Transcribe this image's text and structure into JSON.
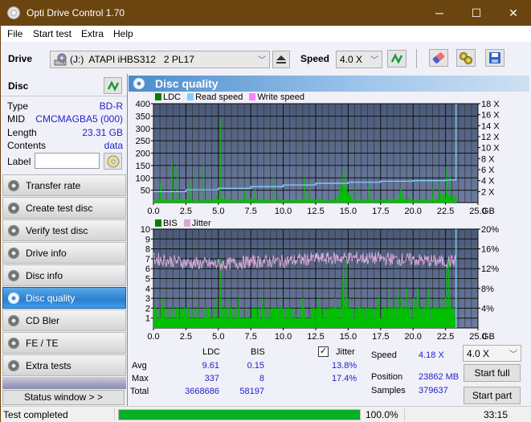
{
  "window": {
    "title": "Opti Drive Control 1.70",
    "controls": {
      "minimize": "─",
      "maximize": "☐",
      "close": "✕"
    }
  },
  "menu": [
    "File",
    "Start test",
    "Extra",
    "Help"
  ],
  "toolbar": {
    "drive_label": "Drive",
    "drive_value": "(J:)  ATAPI iHBS312   2 PL17",
    "speed_label": "Speed",
    "speed_value": "4.0 X",
    "icons": [
      "drive-icon",
      "eject-icon",
      "refresh-icon",
      "erase-icon",
      "settings-icon",
      "save-icon"
    ]
  },
  "disc": {
    "header": "Disc",
    "rows": [
      {
        "key": "Type",
        "value": "BD-R"
      },
      {
        "key": "MID",
        "value": "CMCMAGBA5 (000)"
      },
      {
        "key": "Length",
        "value": "23.31 GB"
      },
      {
        "key": "Contents",
        "value": "data"
      }
    ],
    "label_key": "Label",
    "label_value": ""
  },
  "nav": [
    {
      "label": "Transfer rate",
      "active": false
    },
    {
      "label": "Create test disc",
      "active": false
    },
    {
      "label": "Verify test disc",
      "active": false
    },
    {
      "label": "Drive info",
      "active": false
    },
    {
      "label": "Disc info",
      "active": false
    },
    {
      "label": "Disc quality",
      "active": true
    },
    {
      "label": "CD Bler",
      "active": false
    },
    {
      "label": "FE / TE",
      "active": false
    },
    {
      "label": "Extra tests",
      "active": false
    }
  ],
  "status_window_button": "Status window > >",
  "panel": {
    "title": "Disc quality"
  },
  "colors": {
    "ldc": "#00c000",
    "read_speed": "#7fd0ff",
    "write_speed": "#ff80ff",
    "bis": "#00c000",
    "jitter": "#d8a8d8",
    "plot_bg_top": "#4a5a78",
    "plot_bg_bottom": "#6c7ca0",
    "accent": "#2b7fd0",
    "progress": "#06b025"
  },
  "chart_data": [
    {
      "type": "bar",
      "title": "LDC / Read speed",
      "legend": [
        "LDC",
        "Read speed",
        "Write speed"
      ],
      "legend_placement": "top-left",
      "x_ticks": [
        "0.0",
        "2.5",
        "5.0",
        "7.5",
        "10.0",
        "12.5",
        "15.0",
        "17.5",
        "20.0",
        "22.5",
        "25.0"
      ],
      "x_unit": "GB",
      "xlim": [
        0,
        25
      ],
      "y_ticks": [
        "50",
        "100",
        "150",
        "200",
        "250",
        "300",
        "350",
        "400"
      ],
      "ylim": [
        0,
        400
      ],
      "y2_ticks": [
        "2 X",
        "4 X",
        "6 X",
        "8 X",
        "10 X",
        "12 X",
        "14 X",
        "16 X",
        "18 X"
      ],
      "y2lim": [
        0,
        18
      ],
      "grid": true,
      "end_marker_gb": 23.31,
      "ldc_peaks": [
        [
          0.3,
          40
        ],
        [
          0.5,
          75
        ],
        [
          1.4,
          162
        ],
        [
          1.8,
          150
        ],
        [
          2.8,
          85
        ],
        [
          3.2,
          130
        ],
        [
          3.8,
          155
        ],
        [
          5.15,
          337
        ],
        [
          7.0,
          50
        ],
        [
          7.8,
          60
        ],
        [
          9.2,
          105
        ],
        [
          11.6,
          100
        ],
        [
          12.0,
          90
        ],
        [
          14.5,
          110
        ],
        [
          14.75,
          150
        ],
        [
          15.5,
          60
        ],
        [
          16.5,
          70
        ],
        [
          19.0,
          55
        ],
        [
          21.5,
          65
        ],
        [
          22.0,
          80
        ],
        [
          22.5,
          145
        ],
        [
          22.8,
          110
        ]
      ],
      "read_speed": [
        [
          0,
          2.0
        ],
        [
          2.5,
          2.3
        ],
        [
          5.0,
          2.6
        ],
        [
          7.5,
          2.9
        ],
        [
          10.0,
          3.2
        ],
        [
          12.5,
          3.5
        ],
        [
          15.0,
          3.7
        ],
        [
          17.5,
          3.9
        ],
        [
          20.0,
          4.0
        ],
        [
          22.5,
          4.1
        ],
        [
          23.31,
          4.18
        ]
      ]
    },
    {
      "type": "bar",
      "title": "BIS / Jitter",
      "legend": [
        "BIS",
        "Jitter"
      ],
      "legend_placement": "top-left",
      "x_ticks": [
        "0.0",
        "2.5",
        "5.0",
        "7.5",
        "10.0",
        "12.5",
        "15.0",
        "17.5",
        "20.0",
        "22.5",
        "25.0"
      ],
      "x_unit": "GB",
      "xlim": [
        0,
        25
      ],
      "y_ticks": [
        "1",
        "2",
        "3",
        "4",
        "5",
        "6",
        "7",
        "8",
        "9",
        "10"
      ],
      "ylim": [
        0,
        10
      ],
      "y2_ticks": [
        "4%",
        "8%",
        "12%",
        "16%",
        "20%"
      ],
      "y2lim": [
        0,
        20
      ],
      "grid": true,
      "end_marker_gb": 23.31,
      "bis_peaks": [
        [
          5.15,
          7
        ],
        [
          14.6,
          6
        ],
        [
          14.8,
          7
        ],
        [
          22.5,
          6
        ],
        [
          22.7,
          7
        ]
      ],
      "jitter_mean_pct": [
        [
          0,
          14.0
        ],
        [
          2.5,
          13.2
        ],
        [
          5.0,
          12.8
        ],
        [
          7.5,
          13.4
        ],
        [
          10.0,
          13.5
        ],
        [
          12.5,
          14.0
        ],
        [
          15.0,
          14.2
        ],
        [
          17.5,
          14.0
        ],
        [
          20.0,
          13.8
        ],
        [
          22.5,
          13.4
        ],
        [
          23.31,
          13.6
        ]
      ]
    }
  ],
  "stats": {
    "headers": [
      "LDC",
      "BIS"
    ],
    "rows": [
      {
        "label": "Avg",
        "ldc": "9.61",
        "bis": "0.15",
        "jitter": "13.8%"
      },
      {
        "label": "Max",
        "ldc": "337",
        "bis": "8",
        "jitter": "17.4%"
      },
      {
        "label": "Total",
        "ldc": "3668686",
        "bis": "58197",
        "jitter": ""
      }
    ],
    "jitter_label": "Jitter",
    "jitter_checked": true,
    "speed_label": "Speed",
    "speed_value": "4.18 X",
    "position_label": "Position",
    "position_value": "23862 MB",
    "samples_label": "Samples",
    "samples_value": "379637",
    "speed_select": "4.0 X",
    "start_full": "Start full",
    "start_part": "Start part"
  },
  "statusbar": {
    "text": "Test completed",
    "progress_pct": 100.0,
    "progress_text": "100.0%",
    "time": "33:15"
  }
}
